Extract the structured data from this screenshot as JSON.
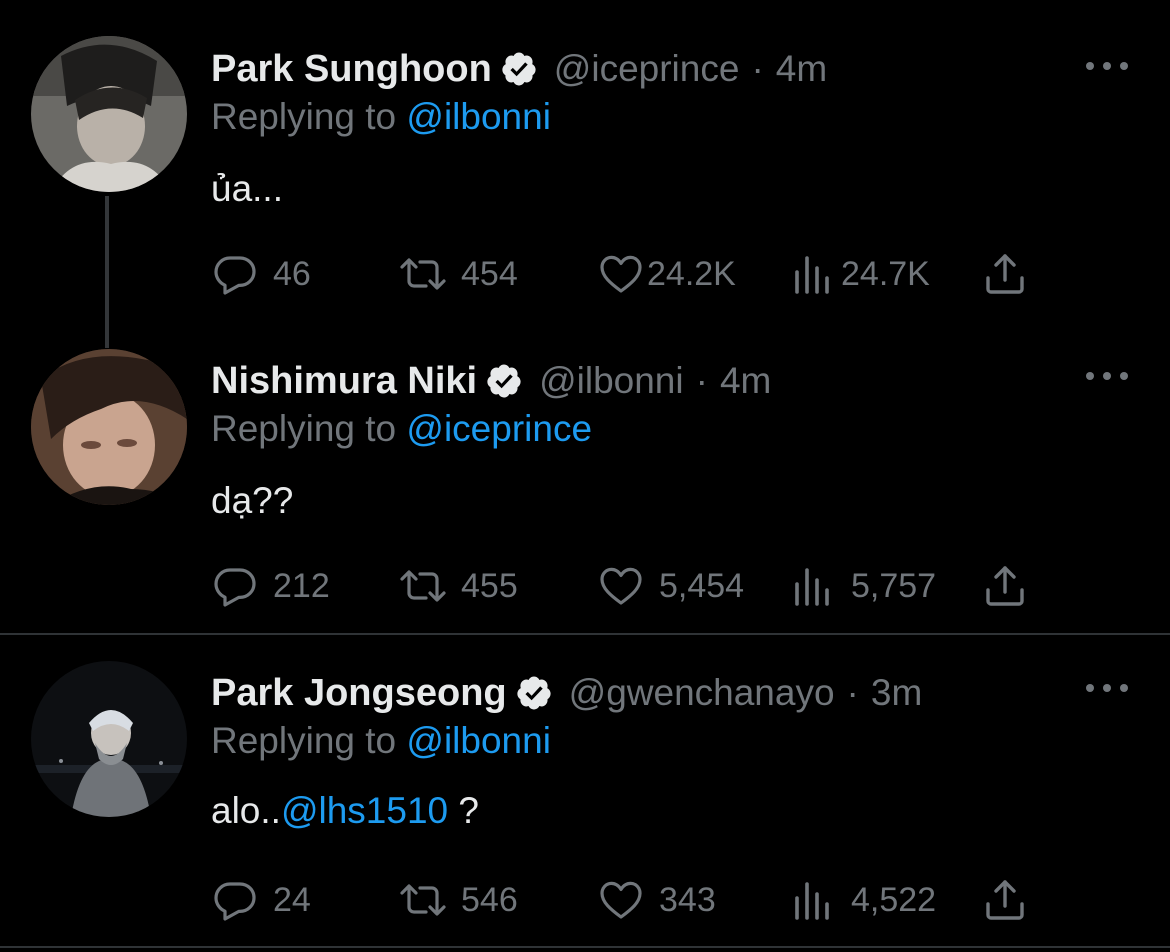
{
  "tweets": [
    {
      "name": "Park Sunghoon",
      "handle": "@iceprince",
      "separator": "·",
      "time": "4m",
      "replying_prefix": "Replying to",
      "replying_to": "@ilbonni",
      "text": "ủa...",
      "replies": "46",
      "retweets": "454",
      "likes": "24.2K",
      "views": "24.7K"
    },
    {
      "name": "Nishimura Niki",
      "handle": "@ilbonni",
      "separator": "·",
      "time": "4m",
      "replying_prefix": "Replying to",
      "replying_to": "@iceprince",
      "text": "dạ??",
      "replies": "212",
      "retweets": "455",
      "likes": "5,454",
      "views": "5,757"
    },
    {
      "name": "Park Jongseong",
      "handle": "@gwenchanayo",
      "separator": "·",
      "time": "3m",
      "replying_prefix": "Replying to",
      "replying_to": "@ilbonni",
      "text_before": "alo..",
      "text_mention": "@lhs1510",
      "text_after": " ?",
      "replies": "24",
      "retweets": "546",
      "likes": "343",
      "views": "4,522"
    }
  ],
  "icons": {
    "verified": "verified-badge-icon",
    "more": "more-icon",
    "reply": "reply-icon",
    "retweet": "retweet-icon",
    "like": "heart-icon",
    "views": "views-icon",
    "share": "share-icon"
  },
  "colors": {
    "background": "#000000",
    "text": "#e7e9ea",
    "muted": "#71767b",
    "link": "#1d9bf0",
    "divider": "#2f3336"
  }
}
